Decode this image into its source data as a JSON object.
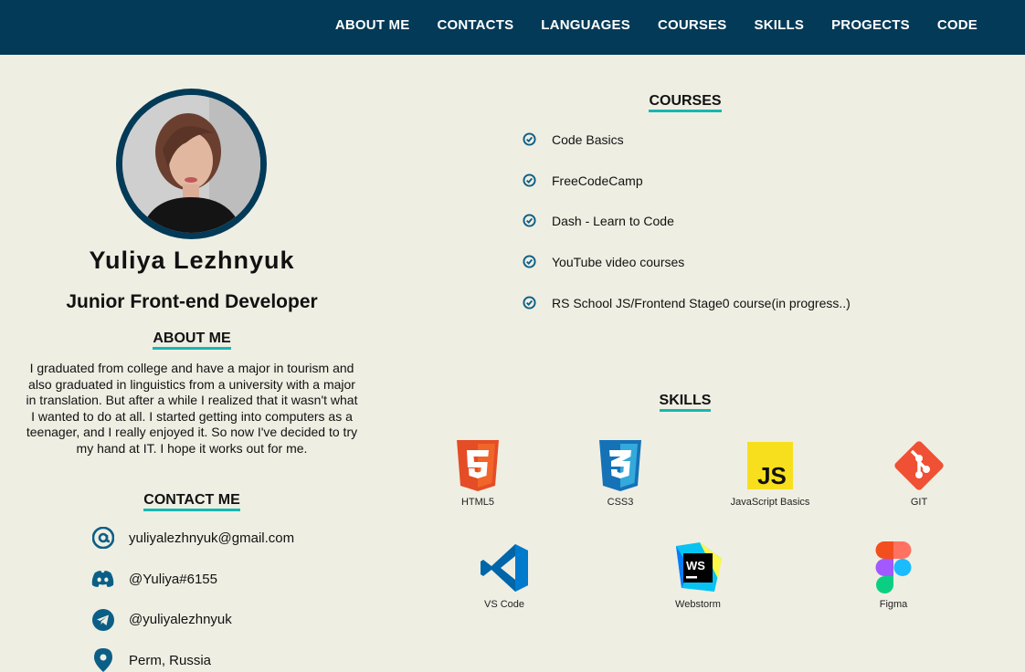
{
  "nav": {
    "items": [
      "ABOUT ME",
      "CONTACTS",
      "LANGUAGES",
      "COURSES",
      "SKILLS",
      "PROGECTS",
      "CODE"
    ]
  },
  "profile": {
    "name": "Yuliya Lezhnyuk",
    "role": "Junior Front-end Developer"
  },
  "about": {
    "title": "ABOUT ME",
    "text": "I graduated from college and have a major in tourism and also graduated in linguistics from a university with a major in translation. But after a while I realized that it wasn't what I wanted to do at all. I started getting into computers as a teenager, and I really enjoyed it. So now I've decided to try my hand at IT. I hope it works out for me."
  },
  "contacts": {
    "title": "CONTACT ME",
    "items": [
      {
        "icon": "email-at-icon",
        "text": "yuliyalezhnyuk@gmail.com"
      },
      {
        "icon": "discord-icon",
        "text": "@Yuliya#6155"
      },
      {
        "icon": "telegram-icon",
        "text": "@yuliyalezhnyuk"
      },
      {
        "icon": "location-pin-icon",
        "text": "Perm, Russia"
      }
    ]
  },
  "courses": {
    "title": "COURSES",
    "items": [
      "Code Basics",
      "FreeCodeCamp",
      "Dash - Learn to Code",
      "YouTube video courses",
      "RS School JS/Frontend Stage0 course(in progress..)"
    ]
  },
  "skills": {
    "title": "SKILLS",
    "items": [
      {
        "icon": "html5-icon",
        "label": "HTML5"
      },
      {
        "icon": "css3-icon",
        "label": "CSS3"
      },
      {
        "icon": "javascript-icon",
        "label": "JavaScript Basics"
      },
      {
        "icon": "git-icon",
        "label": "GIT"
      },
      {
        "icon": "vscode-icon",
        "label": "VS Code"
      },
      {
        "icon": "webstorm-icon",
        "label": "Webstorm"
      },
      {
        "icon": "figma-icon",
        "label": "Figma"
      }
    ]
  },
  "colors": {
    "header": "#023a57",
    "background": "#efeee3",
    "accent_underline": "#17b7b0",
    "icon": "#0b5f86"
  }
}
